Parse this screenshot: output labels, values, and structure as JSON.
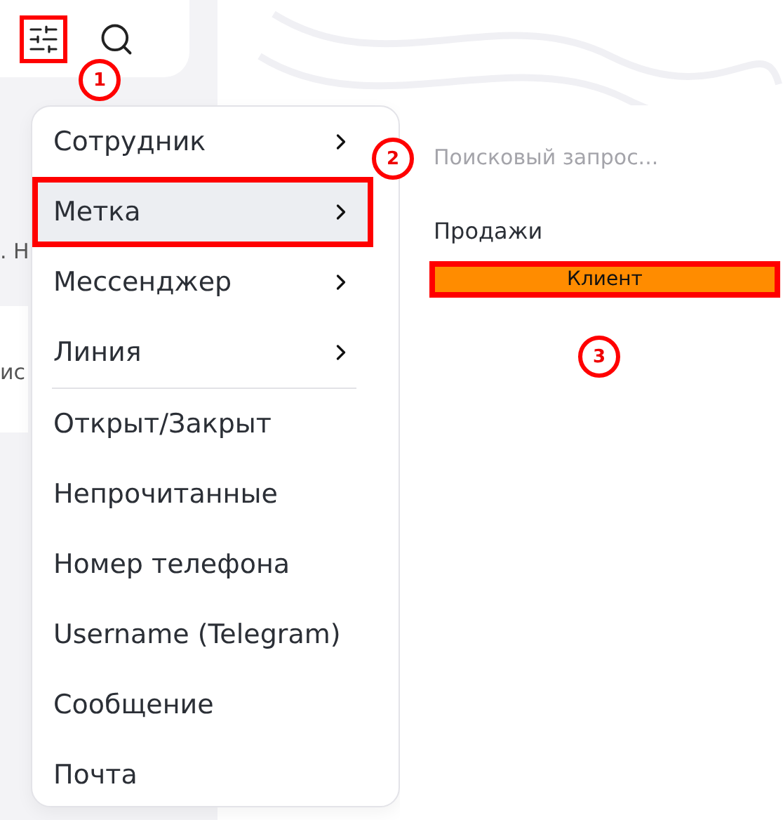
{
  "toolbar": {
    "filter_button": {
      "highlighted": true,
      "callout": "1"
    }
  },
  "background_fragments": [
    ". Н",
    "ис"
  ],
  "menu": {
    "sections": [
      [
        {
          "label": "Сотрудник",
          "submenu": true,
          "selected": false,
          "highlighted": false
        },
        {
          "label": "Метка",
          "submenu": true,
          "selected": true,
          "highlighted": true,
          "callout": "2"
        },
        {
          "label": "Мессенджер",
          "submenu": true,
          "selected": false,
          "highlighted": false
        },
        {
          "label": "Линия",
          "submenu": true,
          "selected": false,
          "highlighted": false
        }
      ],
      [
        {
          "label": "Открыт/Закрыт",
          "submenu": false,
          "selected": false,
          "highlighted": false
        },
        {
          "label": "Непрочитанные",
          "submenu": false,
          "selected": false,
          "highlighted": false
        },
        {
          "label": "Номер телефона",
          "submenu": false,
          "selected": false,
          "highlighted": false
        },
        {
          "label": "Username (Telegram)",
          "submenu": false,
          "selected": false,
          "highlighted": false
        },
        {
          "label": "Сообщение",
          "submenu": false,
          "selected": false,
          "highlighted": false
        },
        {
          "label": "Почта",
          "submenu": false,
          "selected": false,
          "highlighted": false
        }
      ]
    ]
  },
  "submenu": {
    "search": {
      "placeholder": "Поисковый запрос..."
    },
    "groups": [
      {
        "title": "Продажи",
        "tags": [
          {
            "label": "Клиент",
            "color": "#ff8c00",
            "highlighted": true,
            "callout": "3"
          }
        ]
      }
    ]
  }
}
